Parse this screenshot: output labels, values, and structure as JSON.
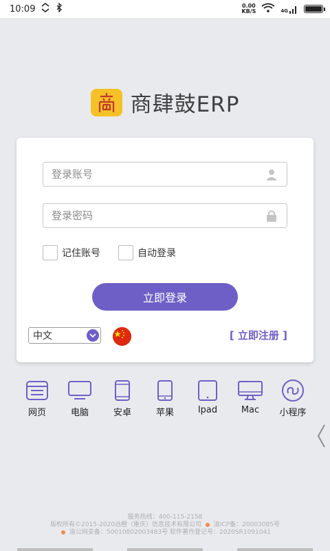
{
  "status": {
    "time": "10:09",
    "speed_value": "0.00",
    "speed_unit": "KB/S",
    "network": "4G"
  },
  "app": {
    "title": "商肆鼓ERP"
  },
  "login": {
    "account_placeholder": "登录账号",
    "password_placeholder": "登录密码",
    "remember_label": "记住账号",
    "auto_login_label": "自动登录",
    "submit_label": "立即登录",
    "language_value": "中文",
    "register_label": "[ 立即注册 ]"
  },
  "platforms": [
    {
      "label": "网页",
      "icon": "browser-icon"
    },
    {
      "label": "电脑",
      "icon": "desktop-icon"
    },
    {
      "label": "安卓",
      "icon": "android-phone-icon"
    },
    {
      "label": "苹果",
      "icon": "iphone-icon"
    },
    {
      "label": "Ipad",
      "icon": "tablet-icon"
    },
    {
      "label": "Mac",
      "icon": "mac-icon"
    },
    {
      "label": "小程序",
      "icon": "mini-program-icon"
    }
  ],
  "footer": {
    "line1": "服务热线：400-115-2158",
    "line2_a": "版权所有©2015-2020远橙（重庆）信息技术有限公司",
    "line2_b": "渝ICP备：20003085号",
    "line3_a": "渝公网安备：50010802003483号",
    "line3_b": "软件著作登记号：2020SR1091041"
  },
  "colors": {
    "accent": "#6e5fc6",
    "logo_bg": "#f6c126",
    "background": "#e9eaee"
  }
}
